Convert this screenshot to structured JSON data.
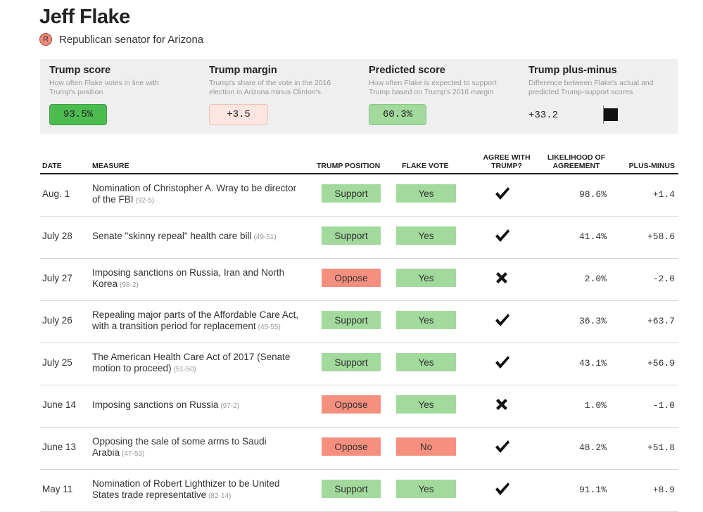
{
  "header": {
    "name": "Jeff Flake",
    "party_badge": "R",
    "subtitle": "Republican senator for Arizona"
  },
  "scores": {
    "trump_score": {
      "title": "Trump score",
      "desc": "How often Flake votes in line with Trump's position",
      "value": "93.5%"
    },
    "trump_margin": {
      "title": "Trump margin",
      "desc": "Trump's share of the vote in the 2016 election in Arizona minus Clinton's",
      "value": "+3.5"
    },
    "predicted_score": {
      "title": "Predicted score",
      "desc": "How often Flake is expected to support Trump based on Trump's 2016 margin",
      "value": "60.3%"
    },
    "plus_minus": {
      "title": "Trump plus-minus",
      "desc": "Difference between Flake's actual and predicted Trump-support scores",
      "value": "+33.2"
    }
  },
  "table": {
    "columns": {
      "date": "DATE",
      "measure": "MEASURE",
      "trump_position": "TRUMP POSITION",
      "flake_vote": "FLAKE VOTE",
      "agree_line1": "AGREE WITH",
      "agree_line2": "TRUMP?",
      "likelihood_line1": "LIKELIHOOD OF",
      "likelihood_line2": "AGREEMENT",
      "plus_minus": "PLUS-MINUS"
    },
    "rows": [
      {
        "date": "Aug. 1",
        "measure": "Nomination of Christopher A. Wray to be director of the FBI",
        "count": "(92-5)",
        "trump_position": "Support",
        "vote": "Yes",
        "agree": "check",
        "likelihood": "98.6%",
        "plus_minus": "+1.4"
      },
      {
        "date": "July 28",
        "measure": "Senate \"skinny repeal\" health care bill",
        "count": "(49-51)",
        "trump_position": "Support",
        "vote": "Yes",
        "agree": "check",
        "likelihood": "41.4%",
        "plus_minus": "+58.6"
      },
      {
        "date": "July 27",
        "measure": "Imposing sanctions on Russia, Iran and North Korea",
        "count": "(98-2)",
        "trump_position": "Oppose",
        "vote": "Yes",
        "agree": "cross",
        "likelihood": "2.0%",
        "plus_minus": "-2.0"
      },
      {
        "date": "July 26",
        "measure": "Repealing major parts of the Affordable Care Act, with a transition period for replacement",
        "count": "(45-55)",
        "trump_position": "Support",
        "vote": "Yes",
        "agree": "check",
        "likelihood": "36.3%",
        "plus_minus": "+63.7"
      },
      {
        "date": "July 25",
        "measure": "The American Health Care Act of 2017 (Senate motion to proceed)",
        "count": "(51-50)",
        "trump_position": "Support",
        "vote": "Yes",
        "agree": "check",
        "likelihood": "43.1%",
        "plus_minus": "+56.9"
      },
      {
        "date": "June 14",
        "measure": "Imposing sanctions on Russia",
        "count": "(97-2)",
        "trump_position": "Oppose",
        "vote": "Yes",
        "agree": "cross",
        "likelihood": "1.0%",
        "plus_minus": "-1.0"
      },
      {
        "date": "June 13",
        "measure": "Opposing the sale of some arms to Saudi Arabia",
        "count": "(47-53)",
        "trump_position": "Oppose",
        "vote": "No",
        "agree": "check",
        "likelihood": "48.2%",
        "plus_minus": "+51.8"
      },
      {
        "date": "May 11",
        "measure": "Nomination of Robert Lighthizer to be United States trade representative",
        "count": "(82-14)",
        "trump_position": "Support",
        "vote": "Yes",
        "agree": "check",
        "likelihood": "91.1%",
        "plus_minus": "+8.9"
      }
    ]
  },
  "colors": {
    "support": "#a2d99c",
    "oppose": "#f5907e",
    "yes": "#a2d99c",
    "no": "#f5907e",
    "trump_score_box": "#4cbc51",
    "predicted_box": "#a2d99c",
    "margin_box": "#fde6e1",
    "party_badge": "#f08a78"
  },
  "icons": {
    "agree_yes": "check-icon",
    "agree_no": "cross-icon"
  }
}
